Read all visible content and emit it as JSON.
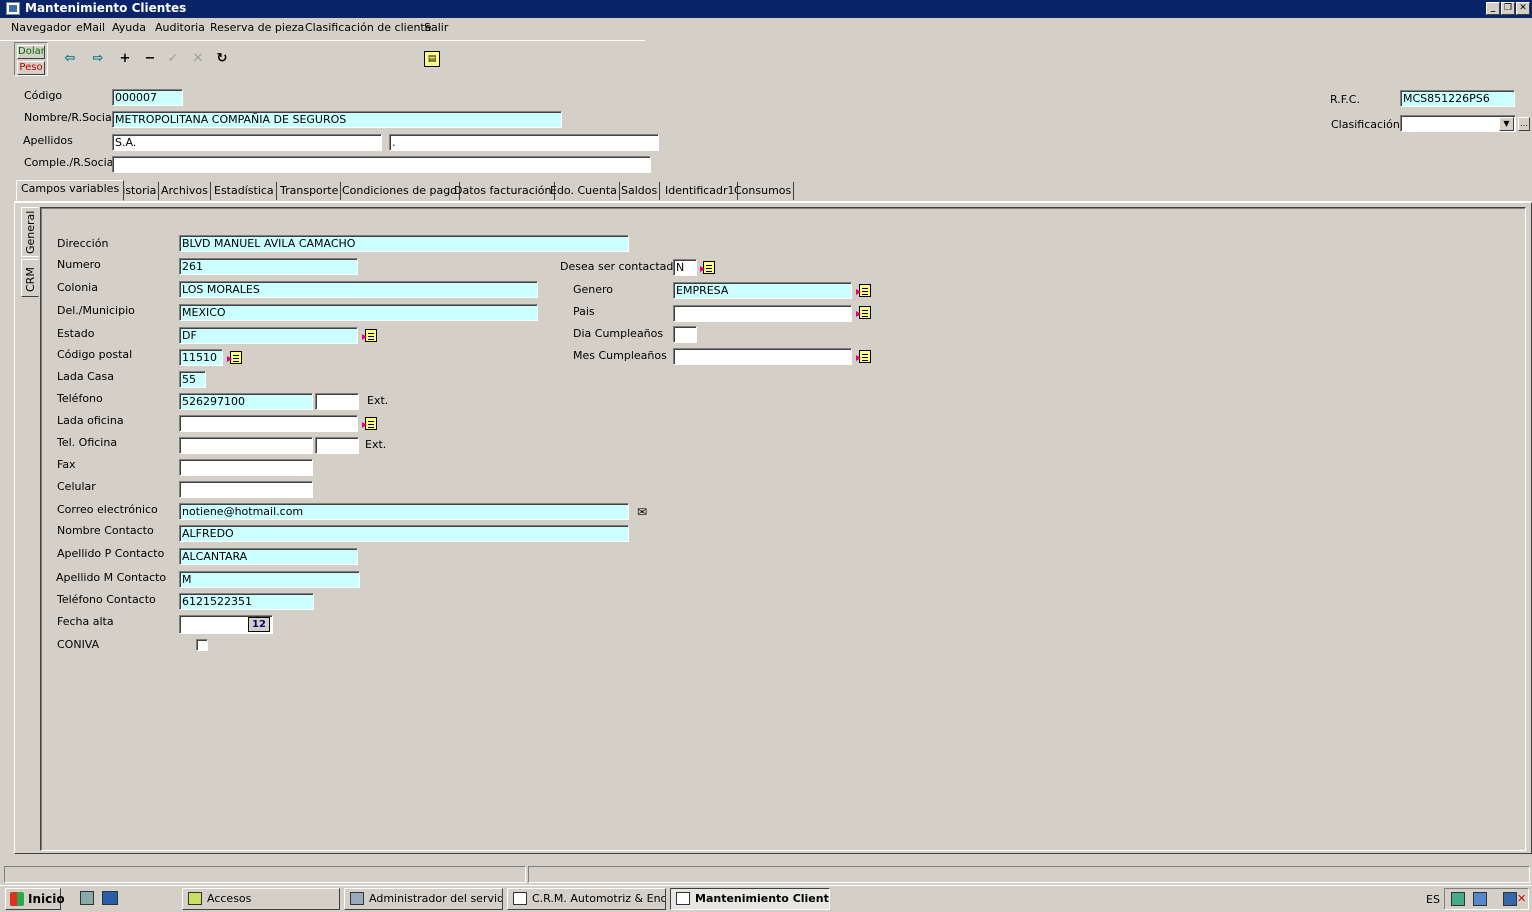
{
  "window": {
    "title": "Mantenimiento Clientes"
  },
  "menu": [
    "Navegador",
    "eMail",
    "Ayuda",
    "Auditoria",
    "Reserva de pieza",
    "Clasificación de cliente",
    "Salir"
  ],
  "currency": {
    "dolar": "Dolar",
    "peso": "Peso"
  },
  "header": {
    "codigo_label": "Código",
    "codigo": "000007",
    "nombre_label": "Nombre/R.Social",
    "nombre": "METROPOLITANA COMPAÑIA DE SEGUROS",
    "apellidos_label": "Apellidos",
    "apellido1": "S.A.",
    "apellido2": ".",
    "comple_label": "Comple./R.Social",
    "comple": "",
    "rfc_label": "R.F.C.",
    "rfc": "MCS851226PS6",
    "clasificacion_label": "Clasificación",
    "clasificacion": ""
  },
  "tabs": [
    "Campos variables",
    "Historia",
    "Archivos",
    "Estadística",
    "Transporte",
    "Condiciones de pago",
    "Datos facturación",
    "Edo. Cuenta",
    "Saldos",
    "Identificadr1",
    "Consumos"
  ],
  "side_tabs": [
    "General",
    "CRM"
  ],
  "form": {
    "direccion_label": "Dirección",
    "direccion": "BLVD MANUEL AVILA CAMACHO",
    "numero_label": "Numero",
    "numero": "261",
    "colonia_label": "Colonia",
    "colonia": "LOS MORALES",
    "municipio_label": "Del./Municipio",
    "municipio": "MEXICO",
    "estado_label": "Estado",
    "estado": "DF",
    "cp_label": "Código postal",
    "cp": "11510",
    "lada_casa_label": "Lada Casa",
    "lada_casa": "55",
    "telefono_label": "Teléfono",
    "telefono": "526297100",
    "telefono_ext": "",
    "ext_label": "Ext.",
    "lada_oficina_label": "Lada oficina",
    "lada_oficina": "",
    "tel_oficina_label": "Tel. Oficina",
    "tel_oficina": "",
    "tel_oficina_ext": "",
    "fax_label": "Fax",
    "fax": "",
    "celular_label": "Celular",
    "celular": "",
    "correo_label": "Correo electrónico",
    "correo": "notiene@hotmail.com",
    "nombre_contacto_label": "Nombre Contacto",
    "nombre_contacto": "ALFREDO",
    "apellido_p_label": "Apellido P Contacto",
    "apellido_p": "ALCANTARA",
    "apellido_m_label": "Apellido M Contacto",
    "apellido_m": "M",
    "tel_contacto_label": "Teléfono Contacto",
    "tel_contacto": "6121522351",
    "fecha_alta_label": "Fecha alta",
    "fecha_alta": "",
    "calendar": "12",
    "coniva_label": "CONIVA",
    "contactado_label": "Desea ser contactado",
    "contactado": "N",
    "genero_label": "Genero",
    "genero": "EMPRESA",
    "pais_label": "Pais",
    "pais": "",
    "dia_label": "Dia Cumpleaños",
    "dia": "",
    "mes_label": "Mes Cumpleaños",
    "mes": ""
  },
  "taskbar": {
    "start": "Inicio",
    "items": [
      "Accesos",
      "Administrador del servidor",
      "C.R.M. Automotriz & Enc...",
      "Mantenimiento Client..."
    ],
    "lang": "ES"
  }
}
